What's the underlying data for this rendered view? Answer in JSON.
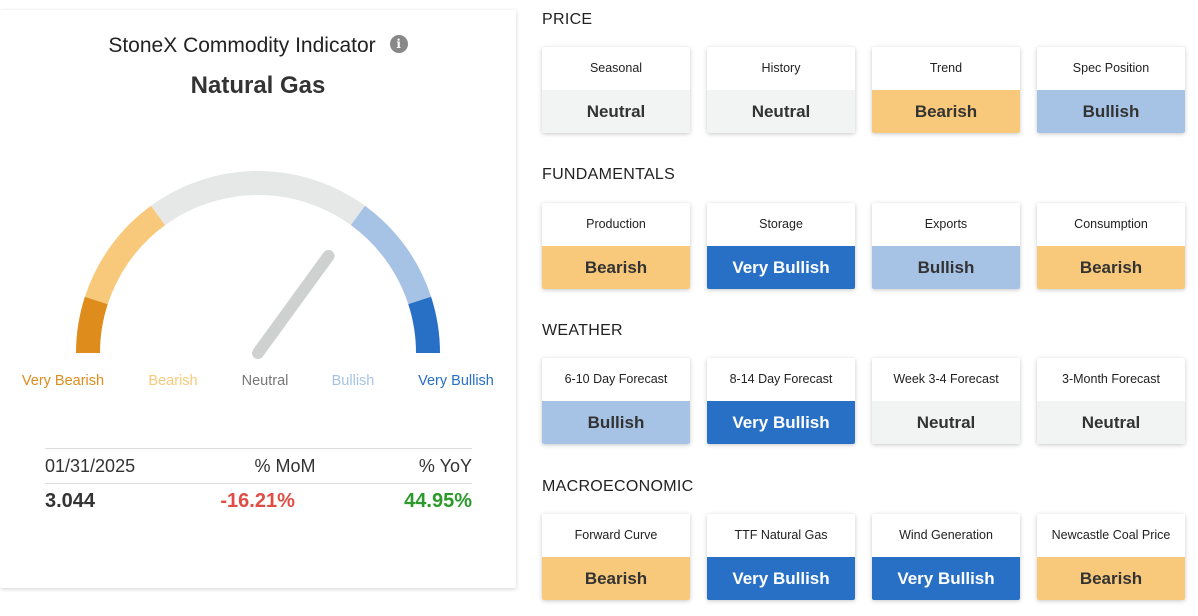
{
  "indicator": {
    "title": "StoneX Commodity Indicator",
    "info_glyph": "i",
    "commodity": "Natural Gas"
  },
  "gauge": {
    "level": 0.7,
    "labels": [
      "Very Bearish",
      "Bearish",
      "Neutral",
      "Bullish",
      "Very Bullish"
    ],
    "colors": {
      "very_bearish": "#de8c1b",
      "bearish": "#f8c97a",
      "neutral": "#e6e7e7",
      "bullish": "#a6c3e6",
      "very_bullish": "#2770c6",
      "needle": "#cfd1d1",
      "neutral_text": "#777777"
    }
  },
  "stats": {
    "date": "01/31/2025",
    "mom_label": "% MoM",
    "yoy_label": "% YoY",
    "price": "3.044",
    "mom_value": "-16.21%",
    "yoy_value": "44.95%"
  },
  "rating_styles": {
    "Neutral": {
      "bg": "#f2f3f3",
      "fg": "#333333"
    },
    "Bearish": {
      "bg": "#f8c97a",
      "fg": "#333333"
    },
    "Bullish": {
      "bg": "#a6c3e6",
      "fg": "#333333"
    },
    "Very Bullish": {
      "bg": "#2770c6",
      "fg": "#ffffff"
    }
  },
  "sections": [
    {
      "title": "PRICE",
      "cards": [
        {
          "label": "Seasonal",
          "value": "Neutral"
        },
        {
          "label": "History",
          "value": "Neutral"
        },
        {
          "label": "Trend",
          "value": "Bearish"
        },
        {
          "label": "Spec Position",
          "value": "Bullish"
        }
      ]
    },
    {
      "title": "FUNDAMENTALS",
      "cards": [
        {
          "label": "Production",
          "value": "Bearish"
        },
        {
          "label": "Storage",
          "value": "Very Bullish"
        },
        {
          "label": "Exports",
          "value": "Bullish"
        },
        {
          "label": "Consumption",
          "value": "Bearish"
        }
      ]
    },
    {
      "title": "WEATHER",
      "cards": [
        {
          "label": "6-10 Day Forecast",
          "value": "Bullish"
        },
        {
          "label": "8-14 Day Forecast",
          "value": "Very Bullish"
        },
        {
          "label": "Week 3-4 Forecast",
          "value": "Neutral"
        },
        {
          "label": "3-Month Forecast",
          "value": "Neutral"
        }
      ]
    },
    {
      "title": "MACROECONOMIC",
      "cards": [
        {
          "label": "Forward Curve",
          "value": "Bearish"
        },
        {
          "label": "TTF Natural Gas",
          "value": "Very Bullish"
        },
        {
          "label": "Wind Generation",
          "value": "Very Bullish"
        },
        {
          "label": "Newcastle Coal Price",
          "value": "Bearish"
        }
      ]
    }
  ]
}
